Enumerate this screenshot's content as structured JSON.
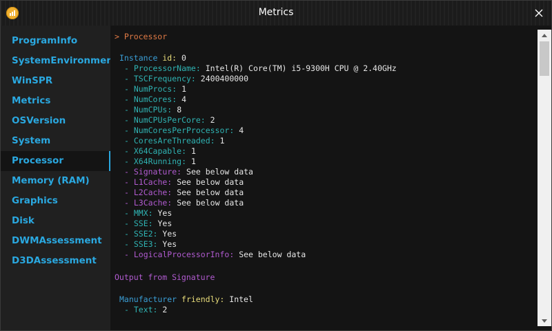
{
  "window": {
    "title": "Metrics"
  },
  "icons": {
    "app": "app-logo-icon",
    "close": "close-icon",
    "up": "scroll-up-arrow-icon",
    "down": "scroll-down-arrow-icon"
  },
  "sidebar": {
    "items": [
      {
        "label": "ProgramInfo"
      },
      {
        "label": "SystemEnvironment"
      },
      {
        "label": "WinSPR"
      },
      {
        "label": "Metrics"
      },
      {
        "label": "OSVersion"
      },
      {
        "label": "System"
      },
      {
        "label": "Processor",
        "active": true
      },
      {
        "label": "Memory (RAM)"
      },
      {
        "label": "Graphics"
      },
      {
        "label": "Disk"
      },
      {
        "label": "DWMAssessment"
      },
      {
        "label": "D3DAssessment"
      }
    ]
  },
  "content": {
    "heading": "> Processor",
    "instance": {
      "label": "Instance",
      "key": "id:",
      "value": "0"
    },
    "props": [
      {
        "key": "- ProcessorName:",
        "value": "Intel(R) Core(TM) i5-9300H CPU @ 2.40GHz",
        "kind": "blue"
      },
      {
        "key": "- TSCFrequency:",
        "value": "2400400000",
        "kind": "blue"
      },
      {
        "key": "- NumProcs:",
        "value": "1",
        "kind": "blue"
      },
      {
        "key": "- NumCores:",
        "value": "4",
        "kind": "blue"
      },
      {
        "key": "- NumCPUs:",
        "value": "8",
        "kind": "blue"
      },
      {
        "key": "- NumCPUsPerCore:",
        "value": "2",
        "kind": "blue"
      },
      {
        "key": "- NumCoresPerProcessor:",
        "value": "4",
        "kind": "blue"
      },
      {
        "key": "- CoresAreThreaded:",
        "value": "1",
        "kind": "blue"
      },
      {
        "key": "- X64Capable:",
        "value": "1",
        "kind": "blue"
      },
      {
        "key": "- X64Running:",
        "value": "1",
        "kind": "blue"
      },
      {
        "key": "- Signature:",
        "value": "See below data",
        "kind": "purple"
      },
      {
        "key": "- L1Cache:",
        "value": "See below data",
        "kind": "purple"
      },
      {
        "key": "- L2Cache:",
        "value": "See below data",
        "kind": "purple"
      },
      {
        "key": "- L3Cache:",
        "value": "See below data",
        "kind": "purple"
      },
      {
        "key": "- MMX:",
        "value": "Yes",
        "kind": "blue"
      },
      {
        "key": "- SSE:",
        "value": "Yes",
        "kind": "blue"
      },
      {
        "key": "- SSE2:",
        "value": "Yes",
        "kind": "blue"
      },
      {
        "key": "- SSE3:",
        "value": "Yes",
        "kind": "blue"
      },
      {
        "key": "- LogicalProcessorInfo:",
        "value": "See below data",
        "kind": "purple"
      }
    ],
    "output_heading": "Output from Signature",
    "manufacturer": {
      "label": "Manufacturer",
      "key": "friendly:",
      "value": "Intel"
    },
    "text_prop": {
      "key": "- Text:",
      "value": "2"
    }
  },
  "colors": {
    "accent": "#2aa8e0",
    "heading": "#e07a45",
    "key": "#3a9ed6",
    "link_key": "#b15bd0",
    "value": "#e6e6e6"
  }
}
